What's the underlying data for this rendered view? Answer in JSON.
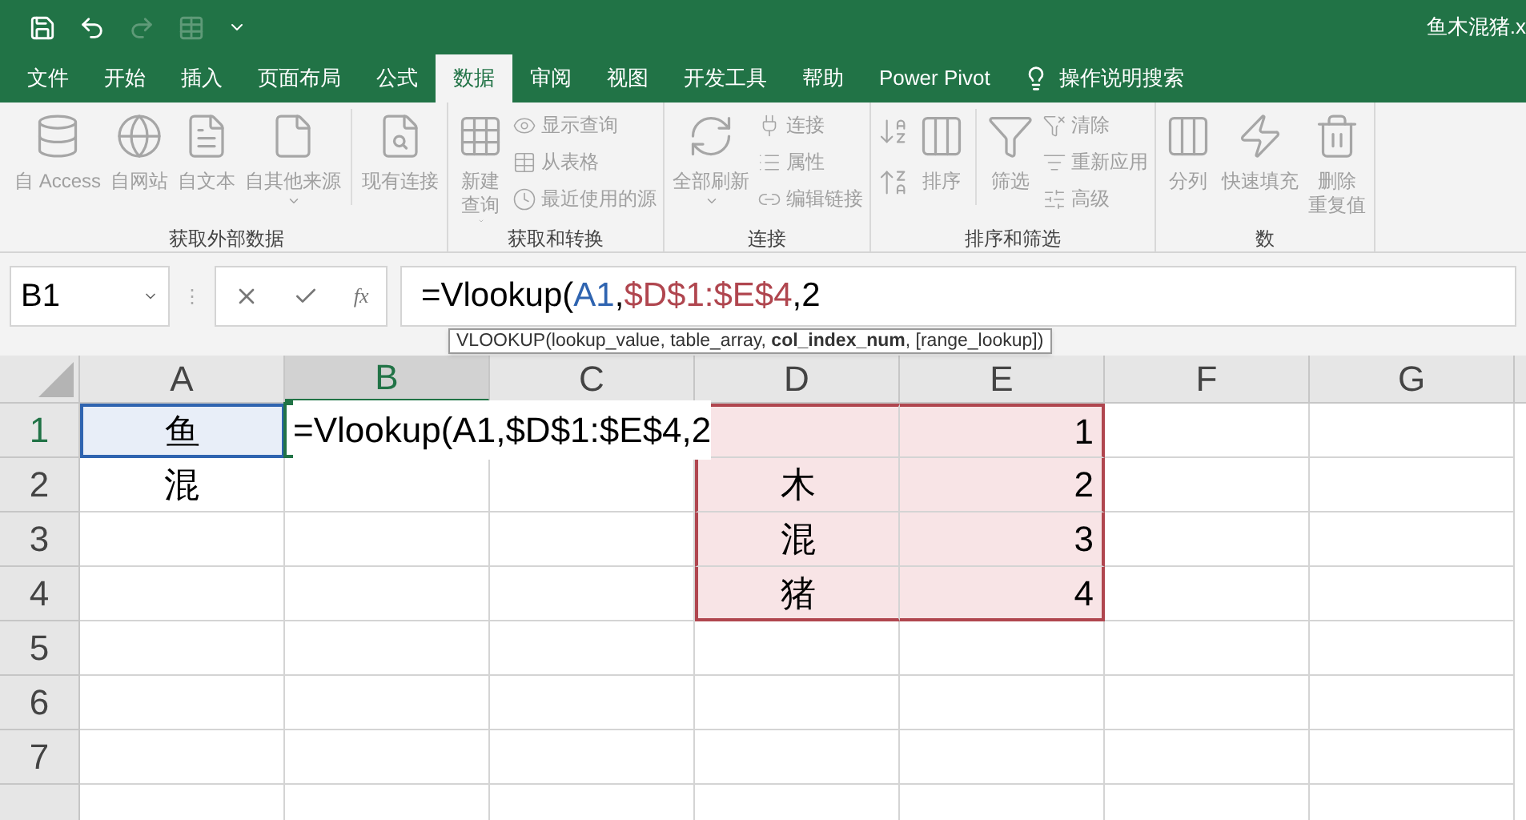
{
  "window": {
    "title": "鱼木混猪.x"
  },
  "tabs": [
    {
      "label": "文件",
      "selected": false
    },
    {
      "label": "开始",
      "selected": false
    },
    {
      "label": "插入",
      "selected": false
    },
    {
      "label": "页面布局",
      "selected": false
    },
    {
      "label": "公式",
      "selected": false
    },
    {
      "label": "数据",
      "selected": true
    },
    {
      "label": "审阅",
      "selected": false
    },
    {
      "label": "视图",
      "selected": false
    },
    {
      "label": "开发工具",
      "selected": false
    },
    {
      "label": "帮助",
      "selected": false
    },
    {
      "label": "Power Pivot",
      "selected": false
    }
  ],
  "tell_me": {
    "placeholder": "操作说明搜索"
  },
  "ribbon_groups": [
    {
      "label": "获取外部数据",
      "items": [
        {
          "kind": "large",
          "label": "自 Access"
        },
        {
          "kind": "large",
          "label": "自网站"
        },
        {
          "kind": "large",
          "label": "自文本"
        },
        {
          "kind": "large",
          "label": "自其他来源",
          "dropdown": true
        },
        {
          "kind": "separator"
        },
        {
          "kind": "large",
          "label": "现有连接"
        }
      ]
    },
    {
      "label": "获取和转换",
      "items": [
        {
          "kind": "large",
          "label": "新建",
          "label2": "查询",
          "dropdown": true
        },
        {
          "kind": "stack",
          "items": [
            {
              "label": "显示查询"
            },
            {
              "label": "从表格"
            },
            {
              "label": "最近使用的源"
            }
          ]
        }
      ]
    },
    {
      "label": "连接",
      "items": [
        {
          "kind": "large",
          "label": "全部刷新",
          "dropdown": true
        },
        {
          "kind": "stack",
          "items": [
            {
              "label": "连接"
            },
            {
              "label": "属性"
            },
            {
              "label": "编辑链接"
            }
          ]
        }
      ]
    },
    {
      "label": "排序和筛选",
      "items": [
        {
          "kind": "sortpair"
        },
        {
          "kind": "large",
          "label": "排序"
        },
        {
          "kind": "separator"
        },
        {
          "kind": "large",
          "label": "筛选"
        },
        {
          "kind": "stack",
          "items": [
            {
              "label": "清除"
            },
            {
              "label": "重新应用"
            },
            {
              "label": "高级"
            }
          ]
        }
      ]
    },
    {
      "label": "数",
      "items": [
        {
          "kind": "large",
          "label": "分列"
        },
        {
          "kind": "large",
          "label": "快速填充"
        },
        {
          "kind": "large",
          "label": "删除",
          "label2": "重复值"
        }
      ]
    }
  ],
  "name_box": {
    "value": "B1"
  },
  "formula_bar": {
    "grip": "⋮",
    "fx": "fx",
    "parts": [
      {
        "text": "=Vlookup("
      },
      {
        "text": "A1",
        "color": "#2f64b0"
      },
      {
        "text": ","
      },
      {
        "text": "$D$1:$E$4",
        "color": "#b0464f"
      },
      {
        "text": ",2"
      }
    ]
  },
  "tooltip": {
    "parts": [
      {
        "text": "VLOOKUP(lookup_value, table_array, "
      },
      {
        "text": "col_index_num",
        "bold": true
      },
      {
        "text": ", [range_lookup])"
      }
    ]
  },
  "columns": [
    {
      "label": "A",
      "selected": false
    },
    {
      "label": "B",
      "selected": true
    },
    {
      "label": "C",
      "selected": false
    },
    {
      "label": "D",
      "selected": false
    },
    {
      "label": "E",
      "selected": false
    },
    {
      "label": "F",
      "selected": false
    },
    {
      "label": "G",
      "selected": false
    }
  ],
  "rows": [
    {
      "label": "1",
      "selected": true,
      "cells": [
        {
          "kind": "text",
          "text": "鱼",
          "color": "#e8eef8"
        },
        {
          "kind": "editing",
          "text": "=Vlookup(A1,$D$1:$E$4,2",
          "active": true
        },
        null,
        {
          "color": "#f8e4e6"
        },
        {
          "kind": "number",
          "text": "1",
          "color": "#f8e4e6"
        },
        null,
        null
      ]
    },
    {
      "label": "2",
      "selected": false,
      "cells": [
        {
          "kind": "text",
          "text": "混"
        },
        null,
        null,
        {
          "kind": "text",
          "text": "木",
          "color": "#f8e4e6"
        },
        {
          "kind": "number",
          "text": "2",
          "color": "#f8e4e6"
        },
        null,
        null
      ]
    },
    {
      "label": "3",
      "selected": false,
      "cells": [
        null,
        null,
        null,
        {
          "kind": "text",
          "text": "混",
          "color": "#f8e4e6"
        },
        {
          "kind": "number",
          "text": "3",
          "color": "#f8e4e6"
        },
        null,
        null
      ]
    },
    {
      "label": "4",
      "selected": false,
      "cells": [
        null,
        null,
        null,
        {
          "kind": "text",
          "text": "猪",
          "color": "#f8e4e6"
        },
        {
          "kind": "number",
          "text": "4",
          "color": "#f8e4e6"
        },
        null,
        null
      ]
    },
    {
      "label": "5",
      "selected": false,
      "cells": [
        null,
        null,
        null,
        null,
        null,
        null,
        null
      ]
    },
    {
      "label": "6",
      "selected": false,
      "cells": [
        null,
        null,
        null,
        null,
        null,
        null,
        null
      ]
    },
    {
      "label": "7",
      "selected": false,
      "cells": [
        null,
        null,
        null,
        null,
        null,
        null,
        null
      ]
    },
    {
      "cells": [
        null,
        null,
        null,
        null,
        null,
        null,
        null
      ]
    }
  ]
}
